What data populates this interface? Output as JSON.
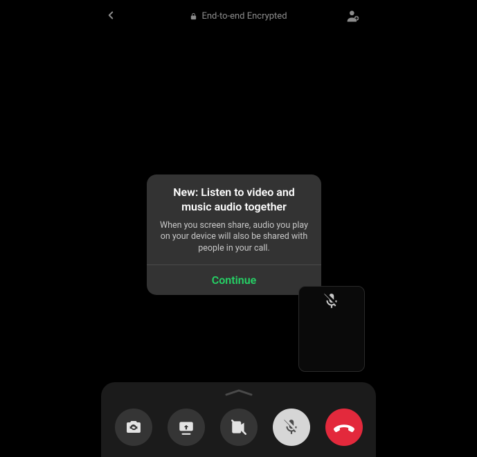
{
  "header": {
    "encrypted_label": "End-to-end Encrypted"
  },
  "dialog": {
    "title": "New: Listen to video and music audio together",
    "description": "When you screen share, audio you play on your device will also be shared with people in your call.",
    "continue_label": "Continue"
  },
  "colors": {
    "accent": "#25d366",
    "end_call": "#e3293c"
  }
}
